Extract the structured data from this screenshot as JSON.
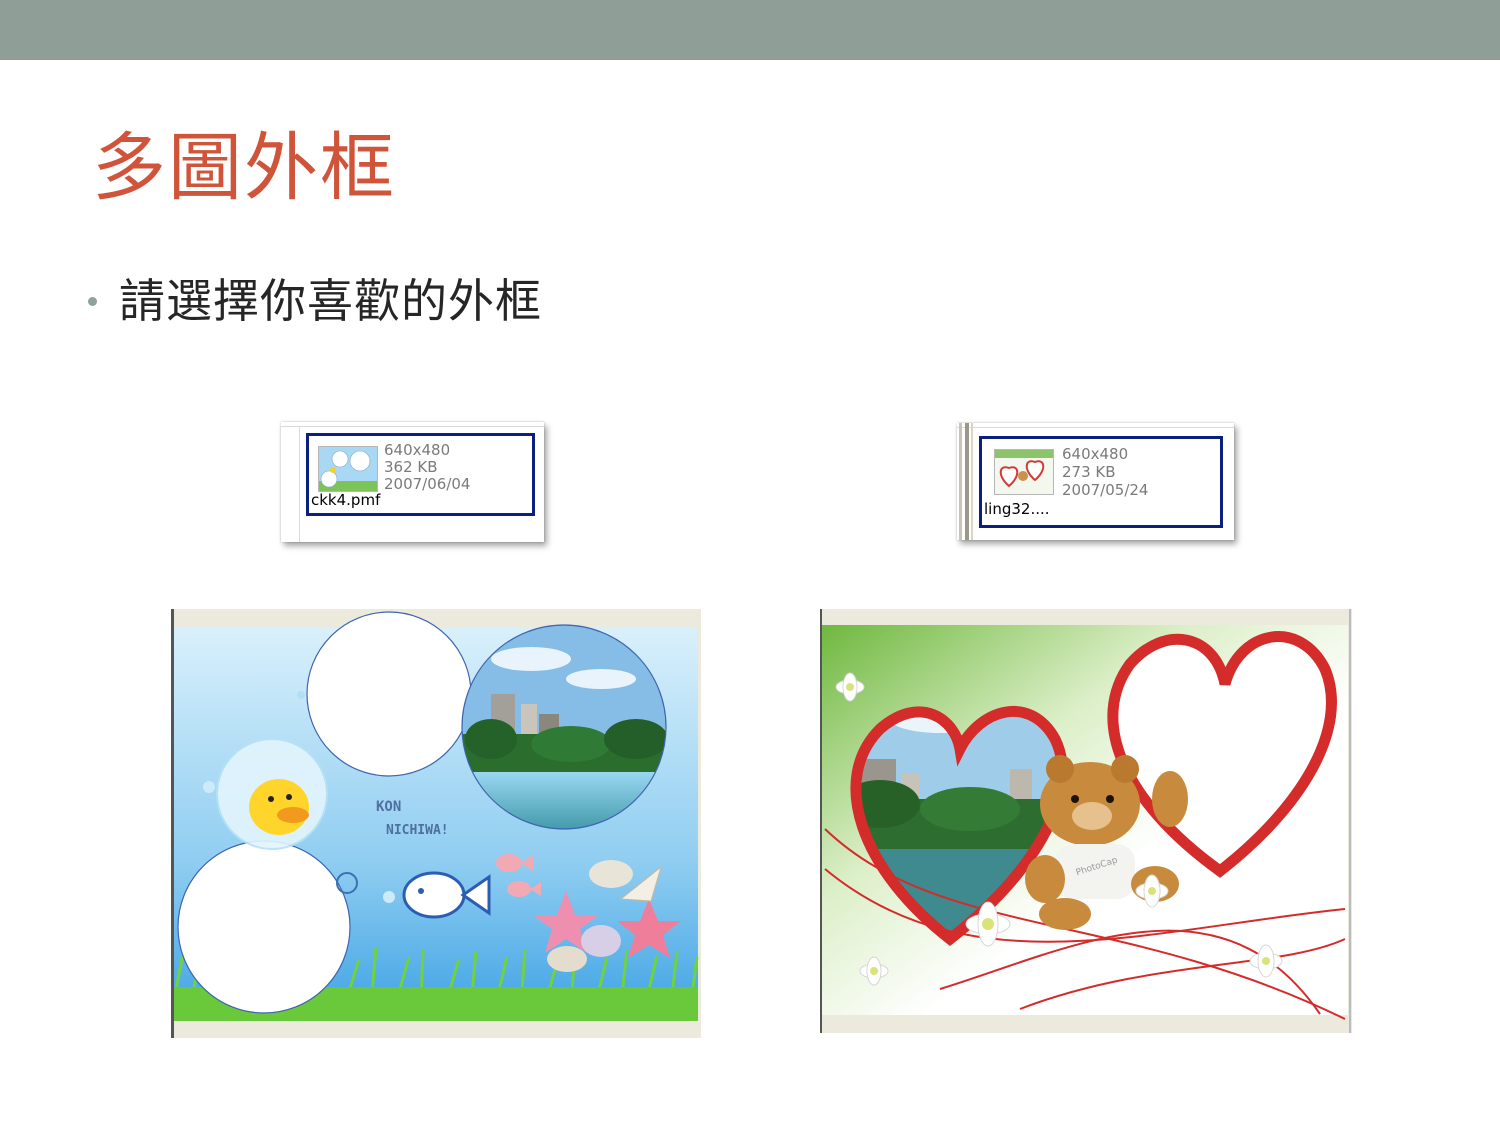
{
  "slide": {
    "title": "多圖外框",
    "bullet": "請選擇你喜歡的外框"
  },
  "files": [
    {
      "dimensions": "640x480",
      "size": "362 KB",
      "date": "2007/06/04",
      "name": "ckk4.pmf"
    },
    {
      "dimensions": "640x480",
      "size": "273 KB",
      "date": "2007/05/24",
      "name": "ling32...."
    }
  ],
  "preview_left": {
    "caption": "KON NICHIWA!",
    "icons": [
      "duck-icon",
      "fish-icon",
      "starfish-icon",
      "shell-icon"
    ]
  },
  "preview_right": {
    "badge": "PhotoCap",
    "icons": [
      "teddy-bear-icon",
      "heart-frame-icon",
      "flower-icon"
    ]
  },
  "colors": {
    "topbar": "#8f9f97",
    "title": "#d0543a",
    "selection": "#0a1f7e"
  }
}
